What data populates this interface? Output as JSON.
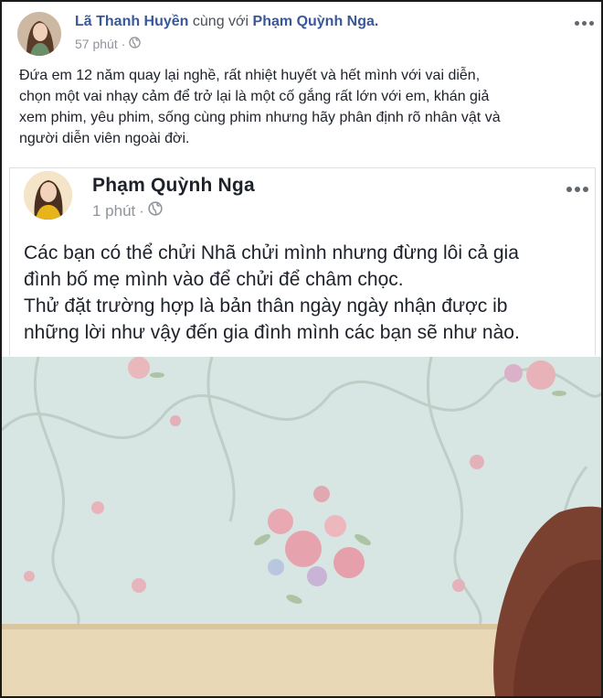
{
  "outer_post": {
    "author": "Lã Thanh Huyền",
    "with_text": "cùng với",
    "tagged": "Phạm Quỳnh Nga.",
    "time": "57 phút",
    "separator": "·",
    "privacy_icon": "globe-icon",
    "more_icon": "more-options-icon",
    "text_lines": [
      "Đứa em 12 năm quay lại nghề, rất nhiệt huyết và hết mình với vai diễn,",
      "chọn một vai nhạy cảm để trở lại là một cố gắng rất lớn với em, khán giả",
      "xem phim, yêu phim, sống cùng phim nhưng hãy phân định rõ nhân vật và",
      "người diễn viên ngoài đời."
    ]
  },
  "shared_post": {
    "author": "Phạm Quỳnh Nga",
    "time": "1 phút",
    "separator": "·",
    "privacy_icon": "globe-icon",
    "more_icon": "more-options-icon",
    "text_lines": [
      "Các bạn có thể chửi Nhã chửi mình nhưng đừng lôi cả gia",
      "đình bố mẹ mình vào để chửi để châm chọc.",
      "Thử đặt trường hợp là bản thân ngày ngày nhận được ib",
      "những lời như vậy đến gia đình mình các bạn sẽ như nào."
    ]
  },
  "colors": {
    "link": "#385898",
    "text": "#1d2129",
    "meta": "#90949c",
    "wallpaper": "#dbe7e6"
  }
}
